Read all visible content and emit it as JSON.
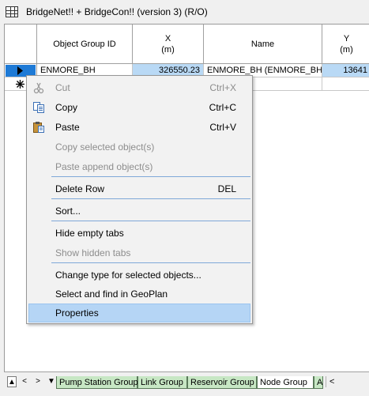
{
  "window": {
    "title": "BridgeNet!! + BridgeCon!! (version 3) (R/O)"
  },
  "grid": {
    "columns": [
      {
        "label": "Object Group ID",
        "unit": ""
      },
      {
        "label": "X",
        "unit": "(m)"
      },
      {
        "label": "Name",
        "unit": ""
      },
      {
        "label": "Y",
        "unit": "(m)"
      }
    ],
    "rows": [
      {
        "object_group_id": "ENMORE_BH",
        "x": "326550.23",
        "name": "ENMORE_BH (ENMORE_BH)",
        "y": "13641"
      }
    ]
  },
  "context_menu": {
    "items": [
      {
        "label": "Cut",
        "shortcut": "Ctrl+X",
        "enabled": false,
        "icon": "scissors-icon"
      },
      {
        "label": "Copy",
        "shortcut": "Ctrl+C",
        "enabled": true,
        "icon": "copy-icon"
      },
      {
        "label": "Paste",
        "shortcut": "Ctrl+V",
        "enabled": true,
        "icon": "paste-icon"
      },
      {
        "label": "Copy selected object(s)",
        "shortcut": "",
        "enabled": false
      },
      {
        "label": "Paste append object(s)",
        "shortcut": "",
        "enabled": false
      },
      {
        "label": "Delete Row",
        "shortcut": "DEL",
        "enabled": true
      },
      {
        "label": "Sort...",
        "shortcut": "",
        "enabled": true
      },
      {
        "label": "Hide empty tabs",
        "shortcut": "",
        "enabled": true
      },
      {
        "label": "Show hidden tabs",
        "shortcut": "",
        "enabled": false
      },
      {
        "label": "Change type for selected objects...",
        "shortcut": "",
        "enabled": true
      },
      {
        "label": "Select and find in GeoPlan",
        "shortcut": "",
        "enabled": true
      },
      {
        "label": "Properties",
        "shortcut": "",
        "enabled": true,
        "highlighted": true
      }
    ]
  },
  "tabs": {
    "nav": [
      "▲",
      "<",
      ">",
      "▼"
    ],
    "items": [
      {
        "label": "Pump Station Group",
        "active": false
      },
      {
        "label": "Link Group",
        "active": false
      },
      {
        "label": "Reservoir Group",
        "active": false
      },
      {
        "label": "Node Group",
        "active": true
      },
      {
        "label": "A",
        "active": false
      }
    ],
    "scroll_left": "<"
  }
}
